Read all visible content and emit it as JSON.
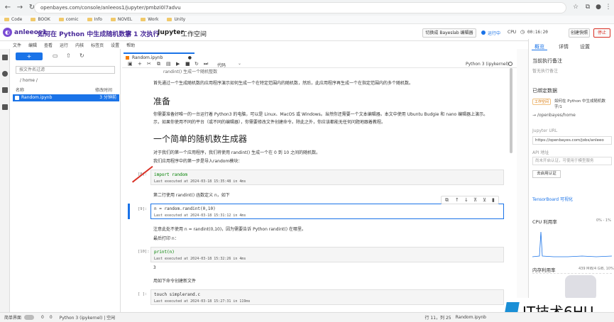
{
  "browser": {
    "url": "openbayes.com/console/anleeos1/jupyter/pmbzi0l7advu",
    "bookmarks": [
      "Code",
      "BOOK",
      "comic",
      "Info",
      "NOVEL",
      "Work",
      "Unity"
    ]
  },
  "app": {
    "user": "anleeos1",
    "title": "如何在 Python 中生成随机数字",
    "run": "第 1 次执行",
    "workspace_bold": "Jupyter",
    "workspace_rest": "工作空间",
    "switch_label": "切换成 Bayeslab 编辑器",
    "status_label": "运行中",
    "cpu": "CPU",
    "timer": "00:16:20",
    "snapshot_label": "创建快照",
    "stop_label": "停止"
  },
  "menu": [
    "文件",
    "编辑",
    "查看",
    "运行",
    "内核",
    "标签页",
    "设置",
    "帮助"
  ],
  "filepanel": {
    "new_label": "+",
    "filter_placeholder": "按文件名过滤",
    "path": "/ home /",
    "col_name": "名称",
    "col_modified": "修改时间",
    "file_name": "Random.ipynb",
    "file_time": "3 分钟前"
  },
  "notebook": {
    "tab_label": "Random.ipynb",
    "cell_type": "代码",
    "kernel": "Python 3 (ipykernel)",
    "line_top": "randint() 生成一个随机整数",
    "para1": "首先通过一个生成随机数的应用程序演示如何生成一个在特定范围内的随机数，然后，此应用程序再生成一个在指定范围内的多个随机数。",
    "h_prep": "准备",
    "para2a": "你需要准备好唯一的一台运行着 Python3 的电脑，可以是 Linux、MacOS 或 Windows。当然你还需要一个文本编辑器。本文中使用 Ubuntu Budgie 和 nano 编辑器上演示。",
    "para2b": "示，如果你使用不同的平台（或不同的编辑器），你需要修改文件创建命令。除此之外，你应该都能无任何问题地跟着教程。",
    "h_gen": "一个简单的随机数生成器",
    "para3": "对于我们的第一个应用程序，我们将使用 randint() 生成一个在 0 到 10 之间的随机数。",
    "para4": "我们应用程序中的第一步是导入random模块：",
    "cell1_prompt": "[8]:",
    "cell1_code": "import random",
    "cell1_exec": "Last executed at 2024-03-18 15:35:48 in 4ms",
    "para5": "第二行使用 randint() 函数定义 n，如下",
    "cell2_prompt": "[9]:",
    "cell2_code": "n = random.randint(0,10)",
    "cell2_exec": "Last executed at 2024-03-18 15:31:12 in 4ms",
    "para6": "注意此处不使用 n = randint(0,10)，因为需要告诉 Python randint() 在哪里。",
    "para7": "最后打印 n：",
    "cell3_prompt": "[10]:",
    "cell3_code": "print(n)",
    "cell3_exec": "Last executed at 2024-03-18 15:32:26 in 4ms",
    "cell3_out": "3",
    "para8": "用如下命令创建新文件",
    "cell4_prompt": "[ ]:",
    "cell4_code": "touch simplerand.c",
    "cell4_exec": "Last executed at 2024-03-18 15:27:31 in 119ms"
  },
  "rightpanel": {
    "tabs": [
      "概览",
      "详情",
      "设置"
    ],
    "remark_title": "当前执行备注",
    "remark_placeholder": "暂无执行备注",
    "bound_title": "已绑定数据",
    "workspace_tag": "工作空间",
    "bound_name": "如何在 Python 中生成随机数字/1",
    "bound_path": "→ /openbayes/home",
    "jupyter_url_title": "Jupyter URL",
    "jupyter_url": "https://openbayes.com/jobs/anleeo",
    "api_title": "API 地址",
    "api_text": "尚未开启认证，可使用于模型服务",
    "api_btn": "去启用认证",
    "tensorboard": "TensorBoard 可视化",
    "cpu_title": "CPU 利用率",
    "cpu_range": "0% - 1%",
    "mem_title": "内存利用率",
    "mem_value": "439 MiB/4 GiB, 10%"
  },
  "statusbar": {
    "mode": "简单界面",
    "zero1": "0",
    "zero2": "0",
    "kernel": "Python 3 (ipykernel) | 空闲",
    "position": "行 11，列 25",
    "file": "Random.ipynb"
  },
  "watermark": "IT技术6HU",
  "colors": {
    "accent": "#1a73e8",
    "brand": "#4a2b9a",
    "stop": "#d93025"
  }
}
